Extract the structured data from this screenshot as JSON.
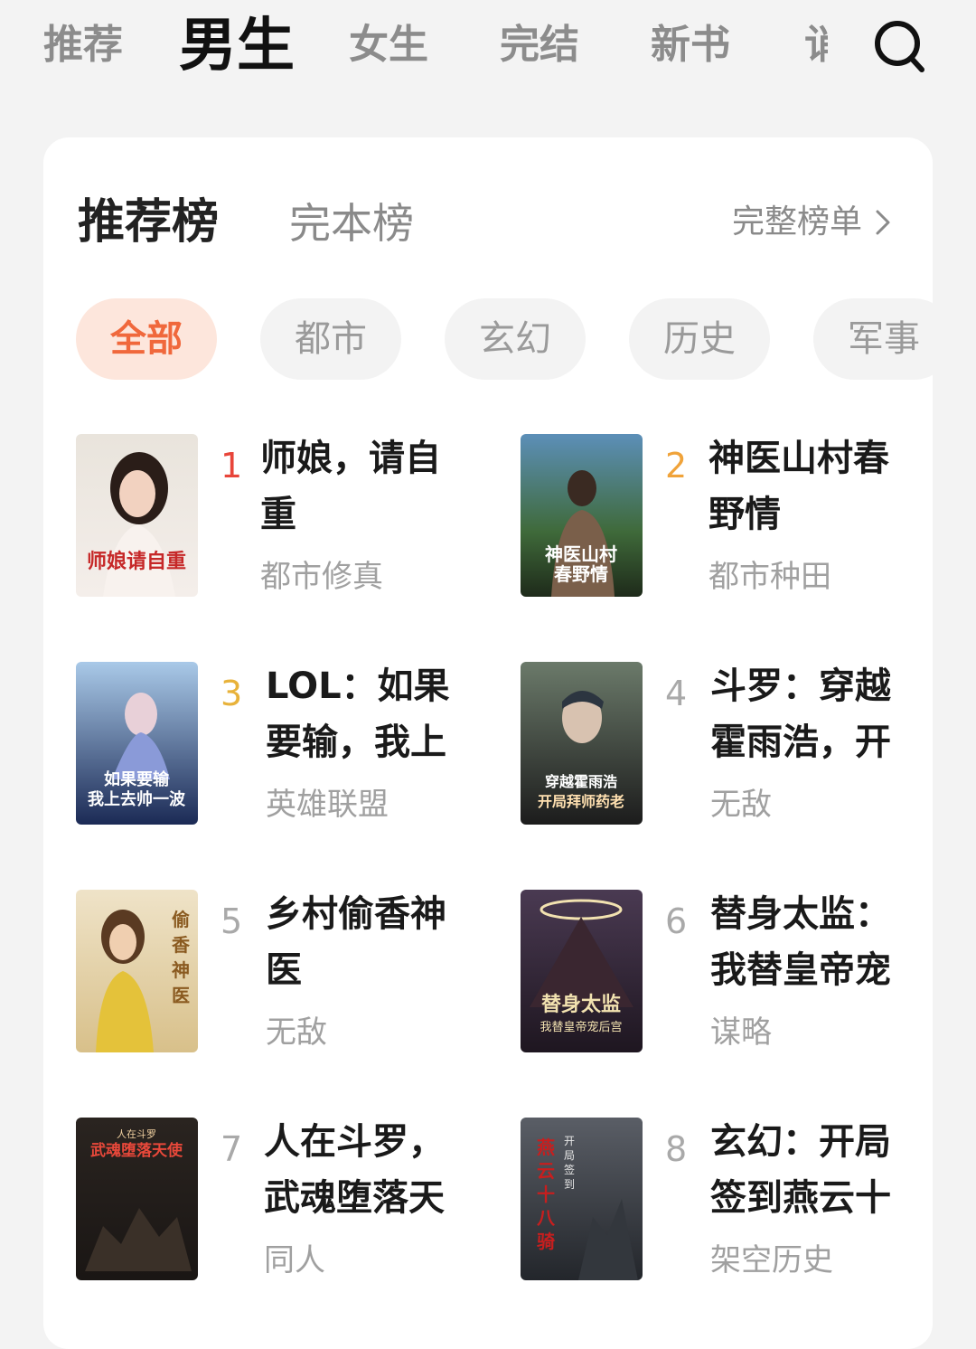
{
  "top_tabs": [
    {
      "label": "推荐"
    },
    {
      "label": "男生",
      "active": true
    },
    {
      "label": "女生"
    },
    {
      "label": "完结"
    },
    {
      "label": "新书"
    },
    {
      "label": "诮"
    }
  ],
  "search_icon": "search-icon",
  "card": {
    "title": "推荐榜",
    "alt_title": "完本榜",
    "full_list_label": "完整榜单",
    "chips": [
      "全部",
      "都市",
      "玄幻",
      "历史",
      "军事"
    ],
    "books": [
      {
        "rank": "1",
        "title": "师娘，请自重",
        "genre": "都市修真",
        "rank_color": "#e8453a",
        "cover_text": "师娘请自重"
      },
      {
        "rank": "2",
        "title": "神医山村春野情",
        "genre": "都市种田",
        "rank_color": "#f0a33a",
        "cover_text": "神医山村春野情"
      },
      {
        "rank": "3",
        "title": "LOL：如果要输，我上",
        "genre": "英雄联盟",
        "rank_color": "#e8b23a",
        "cover_text": "如果要输我上去帅一波"
      },
      {
        "rank": "4",
        "title": "斗罗：穿越霍雨浩，开",
        "genre": "无敌",
        "rank_color": "#a9a9a9",
        "cover_text": "穿越霍雨浩开局拜师药老"
      },
      {
        "rank": "5",
        "title": "乡村偷香神医",
        "genre": "无敌",
        "rank_color": "#a9a9a9",
        "cover_text": "偷香神医"
      },
      {
        "rank": "6",
        "title": "替身太监：我替皇帝宠",
        "genre": "谋略",
        "rank_color": "#a9a9a9",
        "cover_text": "替身太监"
      },
      {
        "rank": "7",
        "title": "人在斗罗，武魂堕落天",
        "genre": "同人",
        "rank_color": "#a9a9a9",
        "cover_text": "武魂堕落天使"
      },
      {
        "rank": "8",
        "title": "玄幻：开局签到燕云十",
        "genre": "架空历史",
        "rank_color": "#a9a9a9",
        "cover_text": "开局签到燕云十八骑"
      }
    ]
  }
}
